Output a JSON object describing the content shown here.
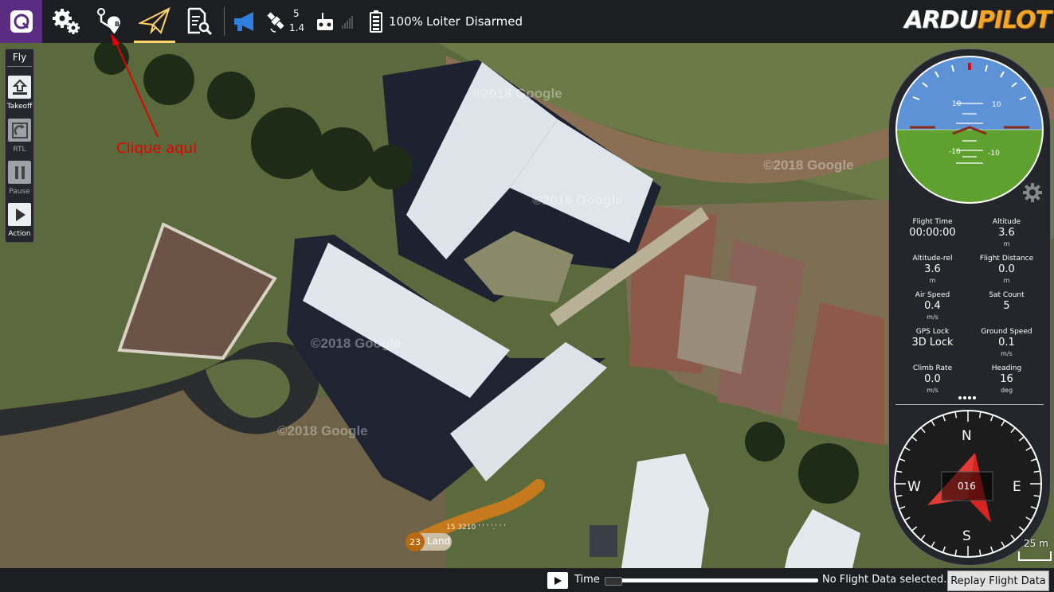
{
  "app": {
    "brand": "ARDUPILOT",
    "brand_parts": [
      "ARDU",
      "PILOT"
    ],
    "colors": {
      "toolbar_bg": "#1c1e22",
      "accent_purple": "#5a2d82",
      "brand_orange": "#f5a623",
      "active_yellow": "#ffd36b",
      "annotation_red": "#e60000"
    }
  },
  "toolbar": {
    "items": [
      {
        "name": "qgc-logo-icon"
      },
      {
        "name": "gears-icon"
      },
      {
        "name": "plan-route-icon"
      },
      {
        "name": "fly-paper-plane-icon"
      },
      {
        "name": "analyze-document-icon"
      }
    ],
    "gps_sat_count": "5",
    "gps_hdop": "1.4",
    "battery": "100%",
    "flight_mode": "Loiter",
    "arm_state": "Disarmed"
  },
  "fly_panel": {
    "title": "Fly",
    "buttons": [
      {
        "label": "Takeoff",
        "icon": "takeoff-icon"
      },
      {
        "label": "RTL",
        "icon": "rtl-icon"
      },
      {
        "label": "Pause",
        "icon": "pause-icon"
      },
      {
        "label": "Action",
        "icon": "play-icon"
      }
    ]
  },
  "annotation": {
    "text": "Clique aqui"
  },
  "map": {
    "watermark": "©2018 Google",
    "waypoint": {
      "number": "23",
      "label": "Land"
    },
    "scale": "25 m"
  },
  "attitude": {
    "pitch_label_pos": "10",
    "pitch_label_neg": "-10"
  },
  "values": [
    {
      "label": "Flight Time",
      "value": "00:00:00",
      "unit": ""
    },
    {
      "label": "Altitude",
      "value": "3.6",
      "unit": "m"
    },
    {
      "label": "Altitude-rel",
      "value": "3.6",
      "unit": "m"
    },
    {
      "label": "Flight Distance",
      "value": "0.0",
      "unit": "m"
    },
    {
      "label": "Air Speed",
      "value": "0.4",
      "unit": "m/s"
    },
    {
      "label": "Sat Count",
      "value": "5",
      "unit": ""
    },
    {
      "label": "GPS Lock",
      "value": "3D Lock",
      "unit": ""
    },
    {
      "label": "Ground Speed",
      "value": "0.1",
      "unit": "m/s"
    },
    {
      "label": "Climb Rate",
      "value": "0.0",
      "unit": "m/s"
    },
    {
      "label": "Heading",
      "value": "16",
      "unit": "deg"
    }
  ],
  "compass": {
    "heading": "016",
    "n": "N",
    "e": "E",
    "s": "S",
    "w": "W"
  },
  "bottom": {
    "time_label": "Time",
    "status": "No Flight Data selected..",
    "replay_button": "Replay Flight Data"
  }
}
